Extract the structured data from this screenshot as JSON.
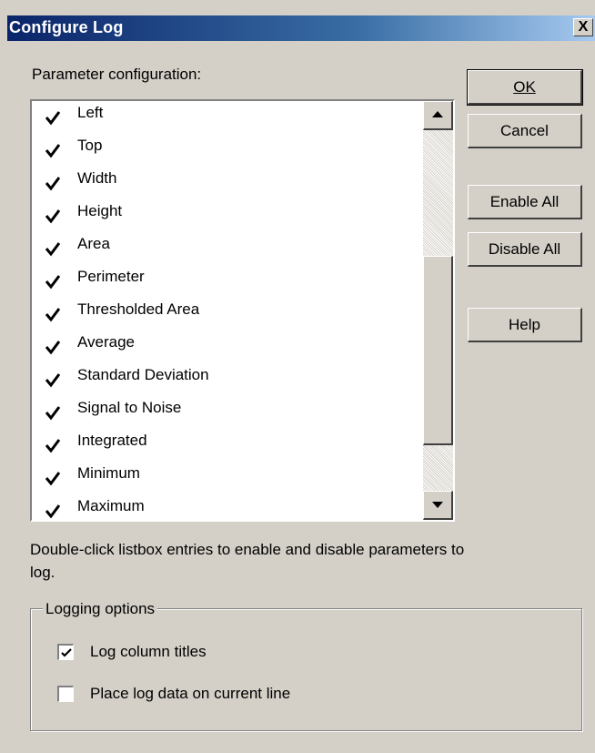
{
  "window": {
    "title": "Configure Log",
    "close_label": "X"
  },
  "param_label": "Parameter configuration:",
  "parameters": [
    {
      "label": "Left",
      "checked": true
    },
    {
      "label": "Top",
      "checked": true
    },
    {
      "label": "Width",
      "checked": true
    },
    {
      "label": "Height",
      "checked": true
    },
    {
      "label": "Area",
      "checked": true
    },
    {
      "label": "Perimeter",
      "checked": true
    },
    {
      "label": "Thresholded Area",
      "checked": true
    },
    {
      "label": "Average",
      "checked": true
    },
    {
      "label": "Standard Deviation",
      "checked": true
    },
    {
      "label": "Signal to Noise",
      "checked": true
    },
    {
      "label": "Integrated",
      "checked": true
    },
    {
      "label": "Minimum",
      "checked": true
    },
    {
      "label": "Maximum",
      "checked": true
    }
  ],
  "hint": "Double-click listbox entries to enable and disable parameters to log.",
  "logging": {
    "label": "Logging options",
    "log_column_titles": {
      "label": "Log column titles",
      "checked": true
    },
    "place_on_current_line": {
      "label": "Place log data on current line",
      "checked": false
    }
  },
  "buttons": {
    "ok": "OK",
    "cancel": "Cancel",
    "enable_all": "Enable All",
    "disable_all": "Disable All",
    "help": "Help"
  }
}
